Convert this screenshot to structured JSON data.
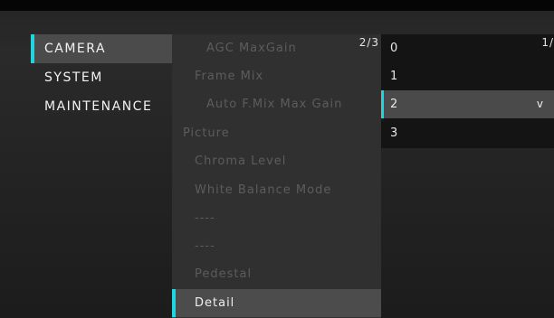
{
  "main_menu": {
    "items": [
      {
        "label": "CAMERA",
        "selected": true
      },
      {
        "label": "SYSTEM",
        "selected": false
      },
      {
        "label": "MAINTENANCE",
        "selected": false
      }
    ]
  },
  "sub_menu": {
    "page": "2/3",
    "items": [
      {
        "label": "AGC MaxGain",
        "enabled": false
      },
      {
        "label": "Frame Mix",
        "enabled": false
      },
      {
        "label": "Auto F.Mix Max Gain",
        "enabled": false
      },
      {
        "label": "Picture",
        "enabled": false
      },
      {
        "label": "Chroma Level",
        "enabled": false
      },
      {
        "label": "White Balance Mode",
        "enabled": false
      },
      {
        "label": "----",
        "enabled": false
      },
      {
        "label": "----",
        "enabled": false
      },
      {
        "label": "Pedestal",
        "enabled": false
      },
      {
        "label": "Detail",
        "enabled": true,
        "selected": true
      }
    ]
  },
  "value_menu": {
    "page": "1/",
    "items": [
      {
        "label": "0"
      },
      {
        "label": "1"
      },
      {
        "label": "2",
        "selected": true,
        "check": "v"
      },
      {
        "label": "3"
      }
    ]
  },
  "colors": {
    "accent": "#21d4e0",
    "selected_bg": "#4b4b4b",
    "disabled_text": "#5c5c5c"
  }
}
